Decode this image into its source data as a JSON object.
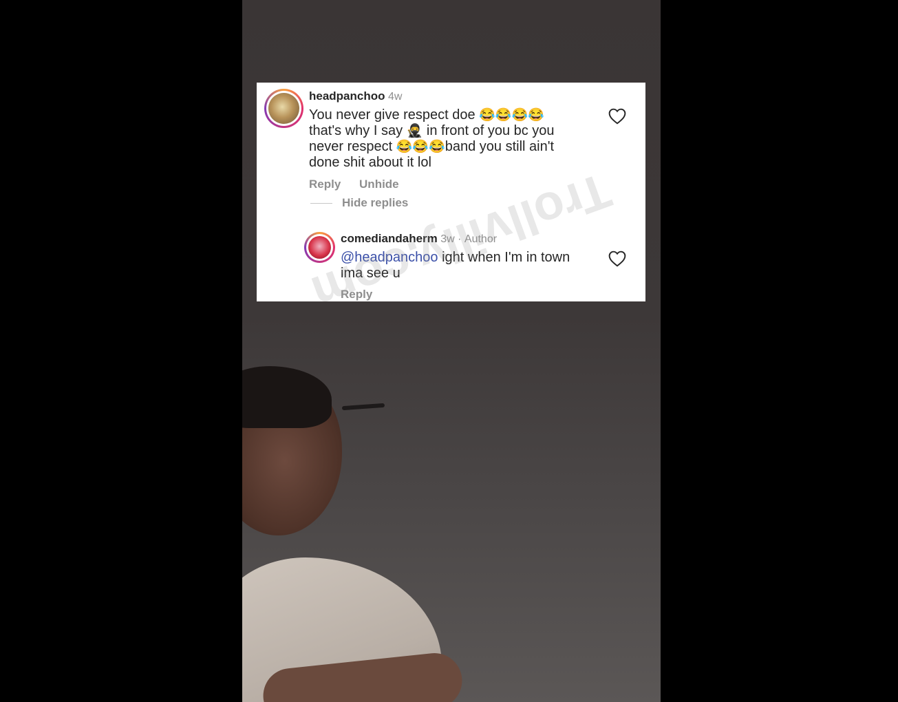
{
  "comment": {
    "username": "headpanchoo",
    "time": "4w",
    "text_line1": "You never give respect doe",
    "emoji_laugh": "😂",
    "text_line2a": "that's why I say",
    "emoji_ninja": "🥷",
    "text_line2b": "in front of you bc you",
    "text_line3a": "never respect",
    "text_line3b": "band you still ain't",
    "text_line4": "done shit about it lol",
    "reply_label": "Reply",
    "unhide_label": "Unhide",
    "hide_replies_label": "Hide replies"
  },
  "reply": {
    "username": "comediandaherm",
    "time": "3w",
    "separator": "·",
    "author_badge": "Author",
    "mention": "@headpanchoo",
    "text_a": "ight when I'm in town",
    "text_b": "ima see u",
    "reply_label": "Reply"
  },
  "watermark": "Trollvilly.com",
  "icons": {
    "like": "heart-icon",
    "avatar": "avatar"
  },
  "colors": {
    "mention": "#3a4fa8",
    "muted": "#8e8e8e",
    "text": "#262626"
  }
}
